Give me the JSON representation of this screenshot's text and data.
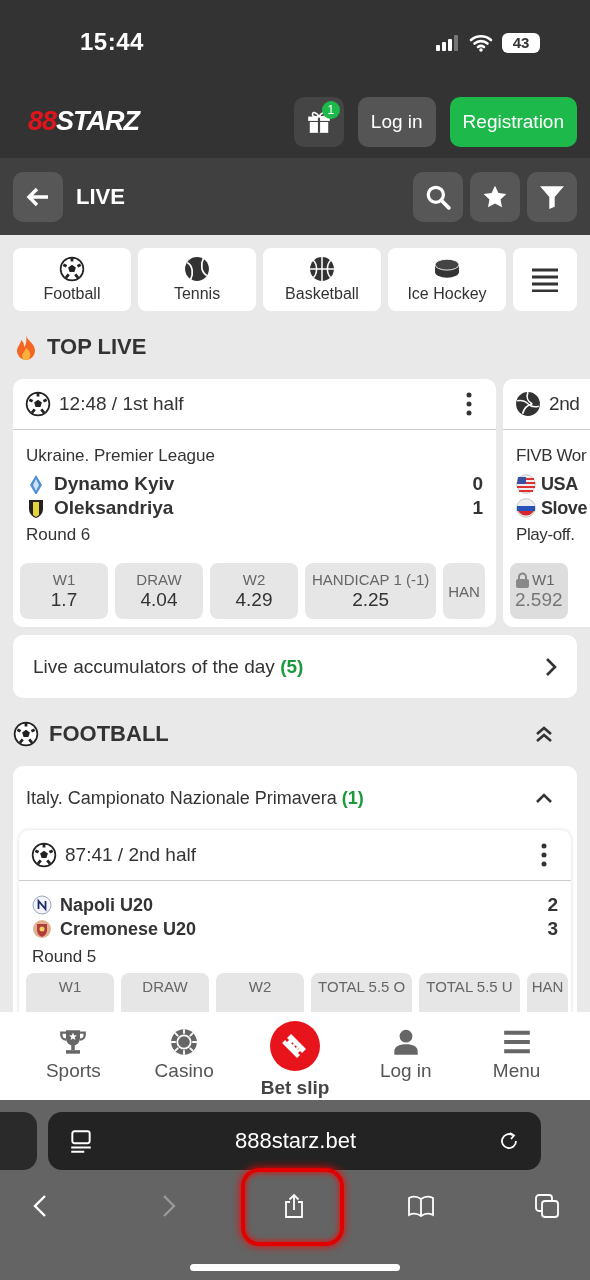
{
  "status_bar": {
    "time": "15:44",
    "battery": "43"
  },
  "header": {
    "logo_mark": "88",
    "logo_name": "STARZ",
    "gift_badge": "1",
    "login": "Log in",
    "register": "Registration"
  },
  "subheader": {
    "title": "LIVE"
  },
  "sport_tabs": [
    {
      "label": "Football",
      "kind": "football"
    },
    {
      "label": "Tennis",
      "kind": "tennis"
    },
    {
      "label": "Basketball",
      "kind": "basketball"
    },
    {
      "label": "Ice Hockey",
      "kind": "hockey"
    }
  ],
  "top_live": {
    "title": "TOP LIVE",
    "matches": [
      {
        "kind": "football",
        "time": "12:48 / 1st half",
        "league": "Ukraine. Premier League",
        "teams": [
          {
            "name": "Dynamo Kyiv",
            "score": "0",
            "kind": "diamond"
          },
          {
            "name": "Oleksandriya",
            "score": "1",
            "kind": "shield"
          }
        ],
        "round": "Round 6",
        "odds": [
          {
            "label": "W1",
            "value": "1.7",
            "locked": false
          },
          {
            "label": "DRAW",
            "value": "4.04",
            "locked": false
          },
          {
            "label": "W2",
            "value": "4.29",
            "locked": false
          },
          {
            "label": "HANDICAP 1 (-1)",
            "value": "2.25",
            "locked": false
          },
          {
            "label": "HAN",
            "locked": false
          }
        ]
      },
      {
        "kind": "volleyball",
        "time": "2nd",
        "league": "FIVB Wor",
        "teams": [
          {
            "name": "USA",
            "kind": "flag-us"
          },
          {
            "name": "Slove",
            "kind": "flag-si"
          }
        ],
        "round": "Play-off.",
        "odds": [
          {
            "label": "W1",
            "value": "2.592",
            "locked": true
          }
        ]
      }
    ]
  },
  "accumulators": {
    "text": "Live accumulators of the day",
    "count": "(5)"
  },
  "football": {
    "title": "FOOTBALL",
    "league": {
      "name": "Italy. Campionato Nazionale Primavera",
      "count": "(1)",
      "expanded": true,
      "match": {
        "kind": "football",
        "time": "87:41 / 2nd half",
        "teams": [
          {
            "name": "Napoli U20",
            "score": "2",
            "kind": "round-n"
          },
          {
            "name": "Cremonese U20",
            "score": "3",
            "kind": "round-c"
          }
        ],
        "round": "Round 5",
        "odds": [
          {
            "label": "W1"
          },
          {
            "label": "DRAW"
          },
          {
            "label": "W2"
          },
          {
            "label": "TOTAL 5.5 O"
          },
          {
            "label": "TOTAL 5.5 U"
          },
          {
            "label": "HAN"
          }
        ]
      }
    }
  },
  "bottom_nav": [
    {
      "label": "Sports",
      "kind": "trophy"
    },
    {
      "label": "Casino",
      "kind": "chip"
    },
    {
      "label": "Bet slip",
      "kind": "ticket"
    },
    {
      "label": "Log in",
      "kind": "person"
    },
    {
      "label": "Menu",
      "kind": "menu"
    }
  ],
  "browser": {
    "url": "888starz.bet"
  }
}
